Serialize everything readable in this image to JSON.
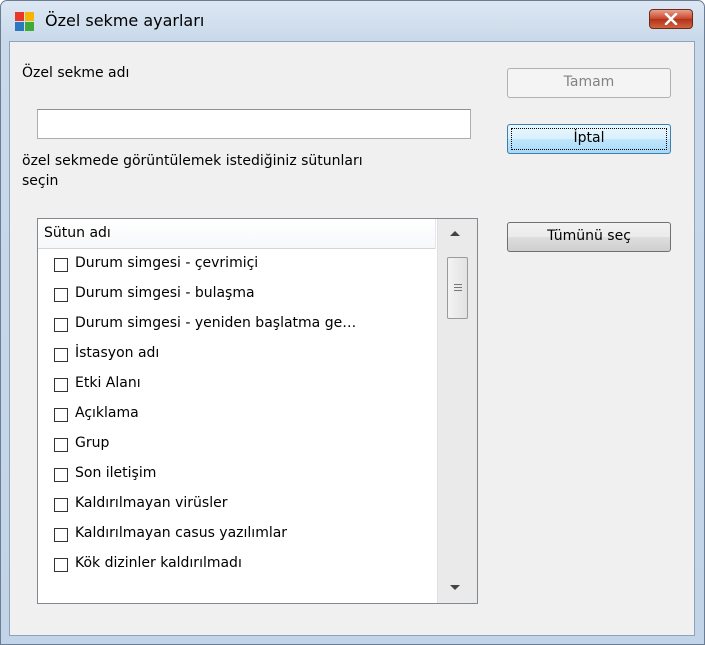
{
  "window": {
    "title": "Özel sekme ayarları",
    "close_icon": "close-x-icon"
  },
  "form": {
    "name_label": "Özel sekme adı",
    "name_value": "",
    "instruction_line1": "özel sekmede görüntülemek istediğiniz sütunları",
    "instruction_line2": "seçin"
  },
  "buttons": {
    "ok": "Tamam",
    "cancel": "İptal",
    "select_all": "Tümünü seç"
  },
  "list": {
    "column_header": "Sütun adı",
    "items": [
      {
        "label": "Durum simgesi - çevrimiçi",
        "checked": false
      },
      {
        "label": "Durum simgesi - bulaşma",
        "checked": false
      },
      {
        "label": "Durum simgesi - yeniden başlatma ge…",
        "checked": false
      },
      {
        "label": "İstasyon adı",
        "checked": false
      },
      {
        "label": "Etki Alanı",
        "checked": false
      },
      {
        "label": "Açıklama",
        "checked": false
      },
      {
        "label": "Grup",
        "checked": false
      },
      {
        "label": "Son iletişim",
        "checked": false
      },
      {
        "label": "Kaldırılmayan virüsler",
        "checked": false
      },
      {
        "label": "Kaldırılmayan casus yazılımlar",
        "checked": false
      },
      {
        "label": "Kök dizinler kaldırılmadı",
        "checked": false
      }
    ]
  },
  "colors": {
    "titlebar": "#c9d9ea",
    "client_bg": "#f0f0f0",
    "close_button": "#c9442a"
  }
}
